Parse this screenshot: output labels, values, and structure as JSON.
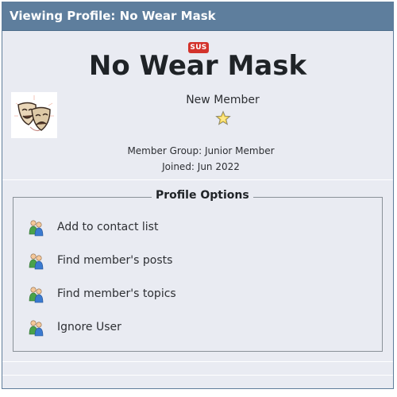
{
  "header": {
    "title": "Viewing Profile: No Wear Mask"
  },
  "profile": {
    "badge": "SUS",
    "name": "No Wear Mask",
    "rank": "New Member",
    "group": "Member Group: Junior Member",
    "joined": "Joined: Jun 2022",
    "avatar_icon": "comedy-tragedy-masks"
  },
  "options": {
    "legend": "Profile Options",
    "items": [
      {
        "label": "Add to contact list",
        "icon": "users-icon"
      },
      {
        "label": "Find member's posts",
        "icon": "users-icon"
      },
      {
        "label": "Find member's topics",
        "icon": "users-icon"
      },
      {
        "label": "Ignore User",
        "icon": "users-icon"
      }
    ]
  },
  "colors": {
    "header": "#5e7e9d",
    "background": "#e9ebf2",
    "badge": "#d3332c"
  }
}
